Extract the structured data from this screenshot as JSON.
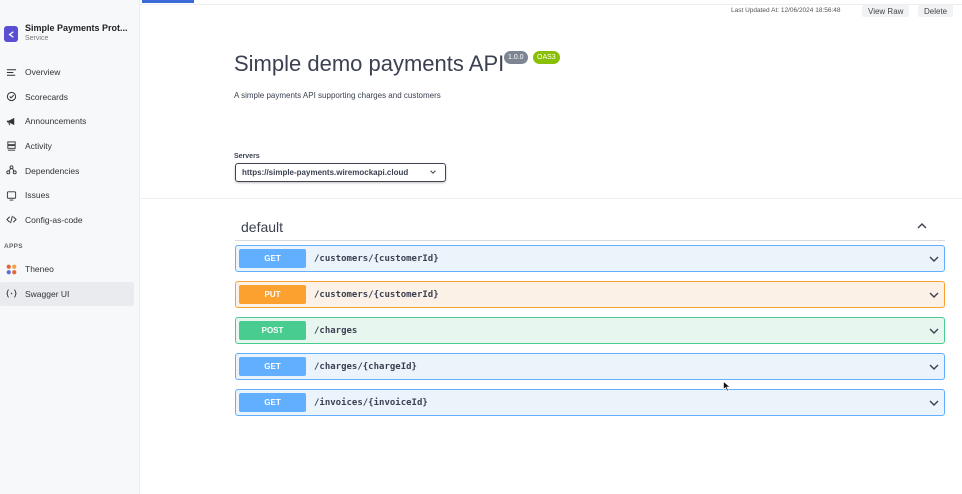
{
  "sidebar": {
    "service_name": "Simple Payments Prot...",
    "service_type": "Service",
    "nav": [
      {
        "label": "Overview",
        "icon": "overview-icon"
      },
      {
        "label": "Scorecards",
        "icon": "scorecards-icon"
      },
      {
        "label": "Announcements",
        "icon": "megaphone-icon"
      },
      {
        "label": "Activity",
        "icon": "activity-icon"
      },
      {
        "label": "Dependencies",
        "icon": "dependencies-icon"
      },
      {
        "label": "Issues",
        "icon": "issues-icon"
      },
      {
        "label": "Config-as-code",
        "icon": "code-icon"
      }
    ],
    "apps_label": "APPS",
    "apps": [
      {
        "label": "Theneo",
        "icon": "theneo-logo-icon"
      },
      {
        "label": "Swagger UI",
        "icon": "swagger-icon",
        "active": true
      }
    ]
  },
  "topbar": {
    "last_updated": "Last Updated At: 12/06/2024 18:56:48",
    "view_raw": "View Raw",
    "delete": "Delete"
  },
  "api": {
    "title": "Simple demo payments API",
    "version_badge": "1.0.0",
    "oas_badge": "OAS3",
    "description": "A simple payments API supporting charges and customers",
    "servers_label": "Servers",
    "server_selected": "https://simple-payments.wiremockapi.cloud"
  },
  "tag": {
    "name": "default"
  },
  "operations": [
    {
      "method": "GET",
      "path": "/customers/{customerId}",
      "color": "#61affe"
    },
    {
      "method": "PUT",
      "path": "/customers/{customerId}",
      "color": "#fca130"
    },
    {
      "method": "POST",
      "path": "/charges",
      "color": "#49cc90"
    },
    {
      "method": "GET",
      "path": "/charges/{chargeId}",
      "color": "#61affe"
    },
    {
      "method": "GET",
      "path": "/invoices/{invoiceId}",
      "color": "#61affe"
    }
  ],
  "colors": {
    "accent": "#5b4fd1",
    "tab_indicator": "#3b6bd6",
    "oas_badge": "#89bf04",
    "version_badge": "#7d8492"
  }
}
